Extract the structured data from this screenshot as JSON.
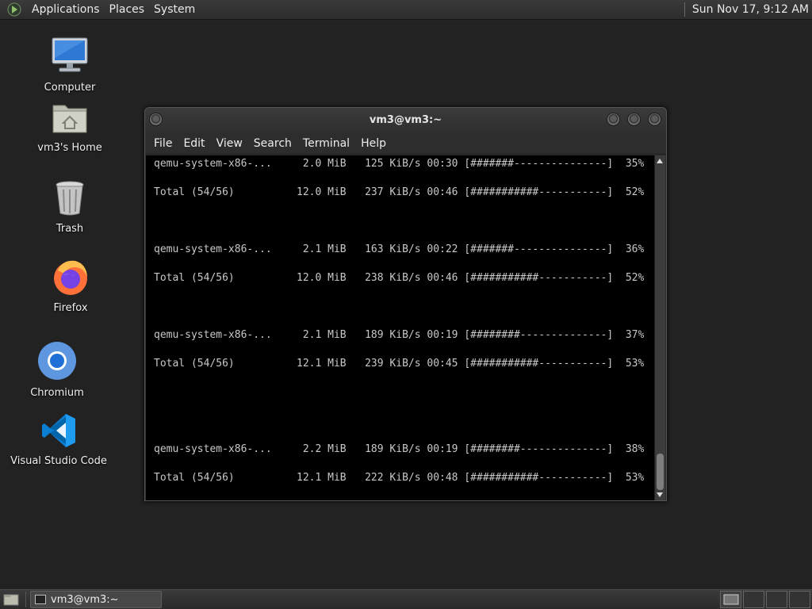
{
  "top_panel": {
    "menus": [
      "Applications",
      "Places",
      "System"
    ],
    "clock": "Sun Nov 17,  9:12 AM"
  },
  "desktop_icons": [
    {
      "label": "Computer",
      "icon": "computer-icon"
    },
    {
      "label": "vm3's Home",
      "icon": "home-folder-icon"
    },
    {
      "label": "Trash",
      "icon": "trash-icon"
    },
    {
      "label": "Firefox",
      "icon": "firefox-icon"
    },
    {
      "label": "Chromium",
      "icon": "chromium-icon"
    },
    {
      "label": "Visual Studio Code",
      "icon": "vscode-icon"
    }
  ],
  "terminal": {
    "title": "vm3@vm3:~",
    "menu": [
      "File",
      "Edit",
      "View",
      "Search",
      "Terminal",
      "Help"
    ],
    "lines": [
      "qemu-system-x86-...     2.0 MiB   125 KiB/s 00:30 [#######---------------]  35%",
      "Total (54/56)          12.0 MiB   237 KiB/s 00:46 [###########-----------]  52%",
      "qemu-system-x86-...     2.1 MiB   163 KiB/s 00:22 [#######---------------]  36%",
      "Total (54/56)          12.0 MiB   238 KiB/s 00:46 [###########-----------]  52%",
      "qemu-system-x86-...     2.1 MiB   189 KiB/s 00:19 [########--------------]  37%",
      "Total (54/56)          12.1 MiB   239 KiB/s 00:45 [###########-----------]  53%",
      "qemu-system-x86-...     2.2 MiB   189 KiB/s 00:19 [########--------------]  38%",
      "Total (54/56)          12.1 MiB   222 KiB/s 00:48 [###########-----------]  53%"
    ]
  },
  "taskbar": {
    "window_label": "vm3@vm3:~"
  }
}
